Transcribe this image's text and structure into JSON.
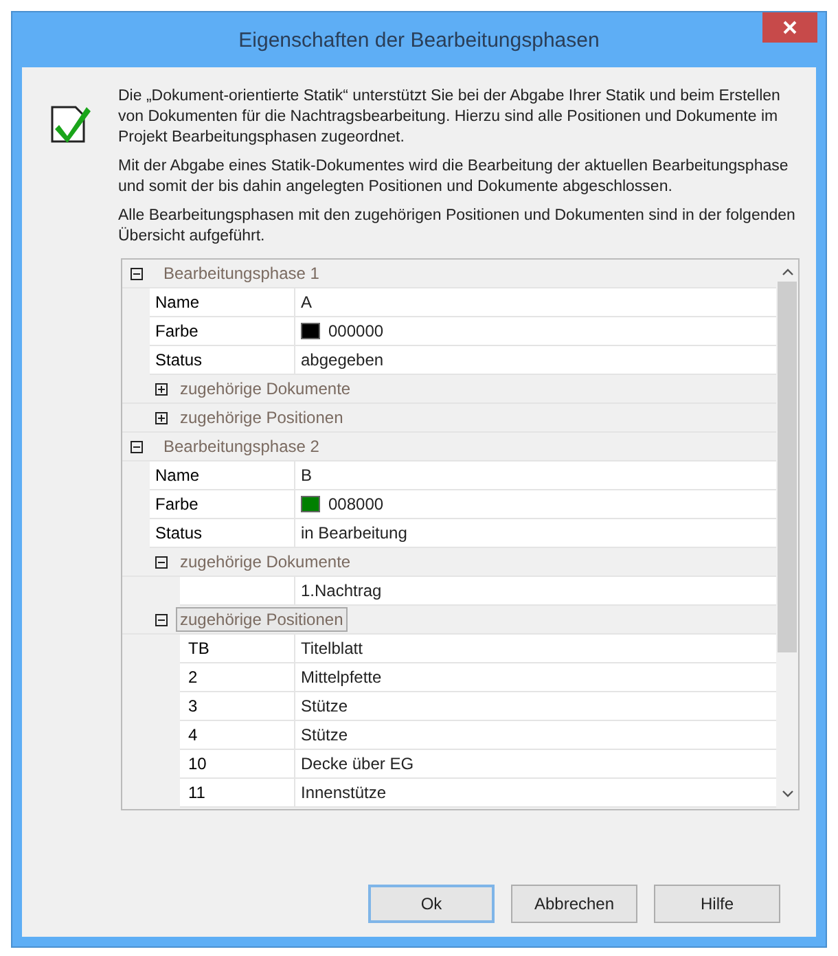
{
  "window": {
    "title": "Eigenschaften der Bearbeitungsphasen"
  },
  "paragraphs": [
    "Die „Dokument-orientierte Statik“ unterstützt Sie bei der Abgabe Ihrer Statik und beim Erstellen von Dokumenten für die Nachtragsbearbeitung. Hierzu sind alle Positionen und Dokumente im Projekt Bearbeitungsphasen zugeordnet.",
    "Mit der Abgabe eines Statik-Dokumentes wird die Bearbeitung der aktuellen Bearbeitungsphase und somit der bis dahin angelegten Positionen und Dokumente abgeschlossen.",
    "Alle Bearbeitungsphasen mit den zugehörigen Positionen und Dokumenten sind in der folgenden Übersicht aufgeführt."
  ],
  "tree": [
    {
      "kind": "phase",
      "label": "Bearbeitungsphase 1",
      "expanded": true,
      "children": [
        {
          "kind": "property",
          "key": "Name",
          "value": "A"
        },
        {
          "kind": "color",
          "key": "Farbe",
          "value": "000000",
          "color": "#000000"
        },
        {
          "kind": "property",
          "key": "Status",
          "value": "abgegeben"
        },
        {
          "kind": "group",
          "label": "zugehörige Dokumente",
          "expanded": false,
          "selected": false
        },
        {
          "kind": "group",
          "label": "zugehörige Positionen",
          "expanded": false,
          "selected": false
        }
      ]
    },
    {
      "kind": "phase",
      "label": "Bearbeitungsphase 2",
      "expanded": true,
      "children": [
        {
          "kind": "property",
          "key": "Name",
          "value": "B"
        },
        {
          "kind": "color",
          "key": "Farbe",
          "value": "008000",
          "color": "#008000"
        },
        {
          "kind": "property",
          "key": "Status",
          "value": "in Bearbeitung"
        },
        {
          "kind": "group",
          "label": "zugehörige Dokumente",
          "expanded": true,
          "selected": false,
          "children": [
            {
              "kind": "entry",
              "value": "1.Nachtrag"
            }
          ]
        },
        {
          "kind": "group",
          "label": "zugehörige Positionen",
          "expanded": true,
          "selected": true,
          "children": [
            {
              "kind": "entry",
              "key": "TB",
              "value": "Titelblatt"
            },
            {
              "kind": "entry",
              "key": "2",
              "value": "Mittelpfette"
            },
            {
              "kind": "entry",
              "key": "3",
              "value": "Stütze"
            },
            {
              "kind": "entry",
              "key": "4",
              "value": "Stütze"
            },
            {
              "kind": "entry",
              "key": "10",
              "value": "Decke über EG"
            },
            {
              "kind": "entry",
              "key": "11",
              "value": "Innenstütze"
            }
          ]
        }
      ]
    }
  ],
  "buttons": [
    {
      "label": "Ok",
      "default": true
    },
    {
      "label": "Abbrechen",
      "default": false
    },
    {
      "label": "Hilfe",
      "default": false
    }
  ]
}
